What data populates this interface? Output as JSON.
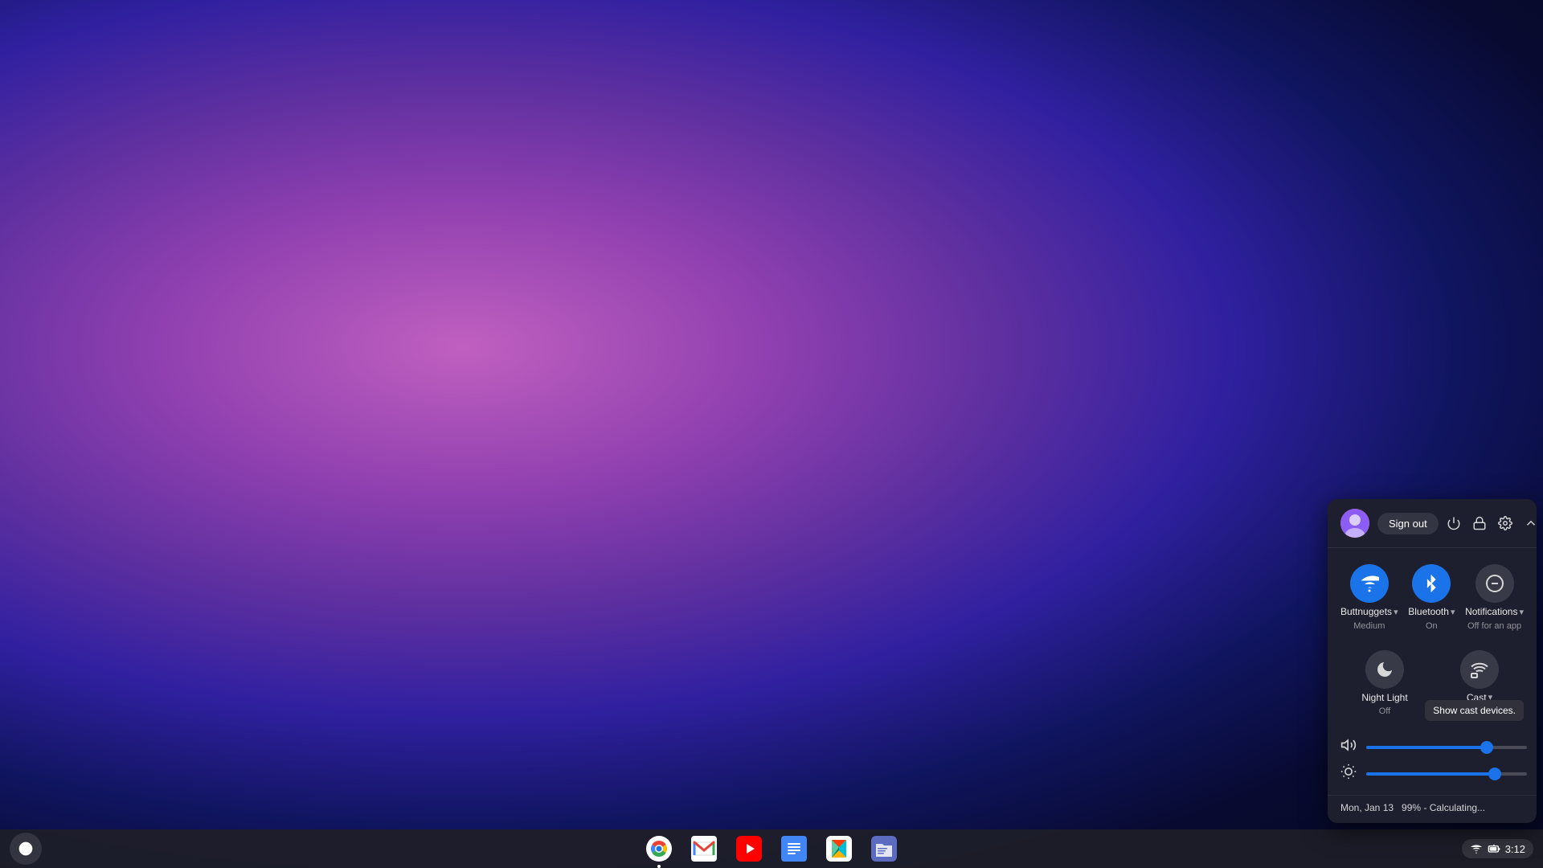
{
  "desktop": {
    "wallpaper_desc": "abstract purple gradient"
  },
  "taskbar": {
    "launcher_icon": "⬤",
    "apps": [
      {
        "id": "chrome",
        "label": "Chrome",
        "icon": "chrome",
        "active": true
      },
      {
        "id": "gmail",
        "label": "Gmail",
        "icon": "gmail",
        "active": false
      },
      {
        "id": "youtube",
        "label": "YouTube",
        "icon": "youtube",
        "active": false
      },
      {
        "id": "docs",
        "label": "Docs",
        "icon": "docs",
        "active": false
      },
      {
        "id": "play",
        "label": "Play Store",
        "icon": "play",
        "active": false
      },
      {
        "id": "files",
        "label": "Files",
        "icon": "files",
        "active": false
      }
    ],
    "tray": {
      "wifi_icon": "wifi",
      "time": "3:12",
      "battery": "▲"
    }
  },
  "quick_panel": {
    "visible": true,
    "header": {
      "sign_out_label": "Sign out",
      "icons": [
        "power",
        "lock",
        "settings",
        "chevron-up"
      ]
    },
    "toggles_row1": [
      {
        "id": "wifi",
        "label": "Buttnuggets",
        "sublabel": "Medium",
        "state": "active",
        "has_arrow": true
      },
      {
        "id": "bluetooth",
        "label": "Bluetooth",
        "sublabel": "On",
        "state": "active",
        "has_arrow": true
      },
      {
        "id": "notifications",
        "label": "Notifications",
        "sublabel": "Off for an app",
        "state": "inactive",
        "has_arrow": true
      }
    ],
    "toggles_row2": [
      {
        "id": "night-light",
        "label": "Night Light",
        "sublabel": "Off",
        "state": "inactive",
        "has_arrow": false
      },
      {
        "id": "cast",
        "label": "Cast",
        "sublabel": "",
        "state": "inactive",
        "has_arrow": true,
        "tooltip": "Show cast devices."
      }
    ],
    "sliders": [
      {
        "id": "volume",
        "icon": "volume",
        "value": 75
      },
      {
        "id": "brightness",
        "icon": "brightness",
        "value": 80
      }
    ],
    "footer": {
      "date": "Mon, Jan 13",
      "battery": "99% - Calculating..."
    }
  }
}
